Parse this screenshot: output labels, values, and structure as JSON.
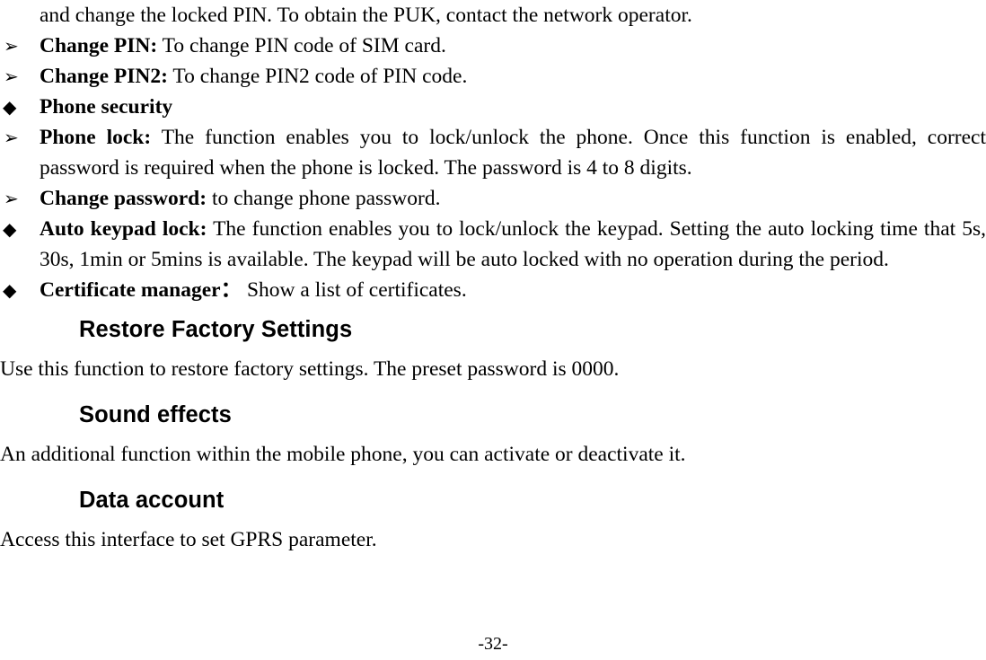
{
  "document": {
    "page_number_label": "-32-"
  },
  "content": {
    "continuation_line": "and change the locked PIN. To obtain the PUK, contact the network operator.",
    "list_items": [
      {
        "bullet": "arrow",
        "bullet_glyph": "➢",
        "lead": "Change PIN:",
        "text": " To change PIN code of SIM card."
      },
      {
        "bullet": "arrow",
        "bullet_glyph": "➢",
        "lead": "Change PIN2:",
        "text": " To change PIN2 code of PIN code."
      },
      {
        "bullet": "diamond",
        "bullet_glyph": "◆",
        "lead": "Phone security",
        "text": ""
      },
      {
        "bullet": "arrow",
        "bullet_glyph": "➢",
        "lead": "Phone lock:",
        "text": " The function enables you to lock/unlock the phone. Once this function is enabled, correct password is required when the phone is locked. The password is 4 to 8 digits."
      },
      {
        "bullet": "arrow",
        "bullet_glyph": "➢",
        "lead": "Change password:",
        "text": " to change phone password."
      },
      {
        "bullet": "diamond",
        "bullet_glyph": "◆",
        "lead": "Auto keypad lock:",
        "text": " The function enables you to lock/unlock the keypad. Setting the auto locking time that 5s, 30s, 1min or 5mins is available. The keypad will be auto locked with no operation during the period."
      },
      {
        "bullet": "diamond",
        "bullet_glyph": "◆",
        "lead": "Certificate manager：",
        "text": "  Show a list of certificates."
      }
    ],
    "sections": [
      {
        "heading": "Restore Factory Settings",
        "body": "Use this function to restore factory settings. The preset password is 0000."
      },
      {
        "heading": "Sound effects",
        "body": "An additional function within the mobile phone, you can activate or deactivate it."
      },
      {
        "heading": "Data account",
        "body": "Access this interface to set GPRS parameter."
      }
    ]
  }
}
